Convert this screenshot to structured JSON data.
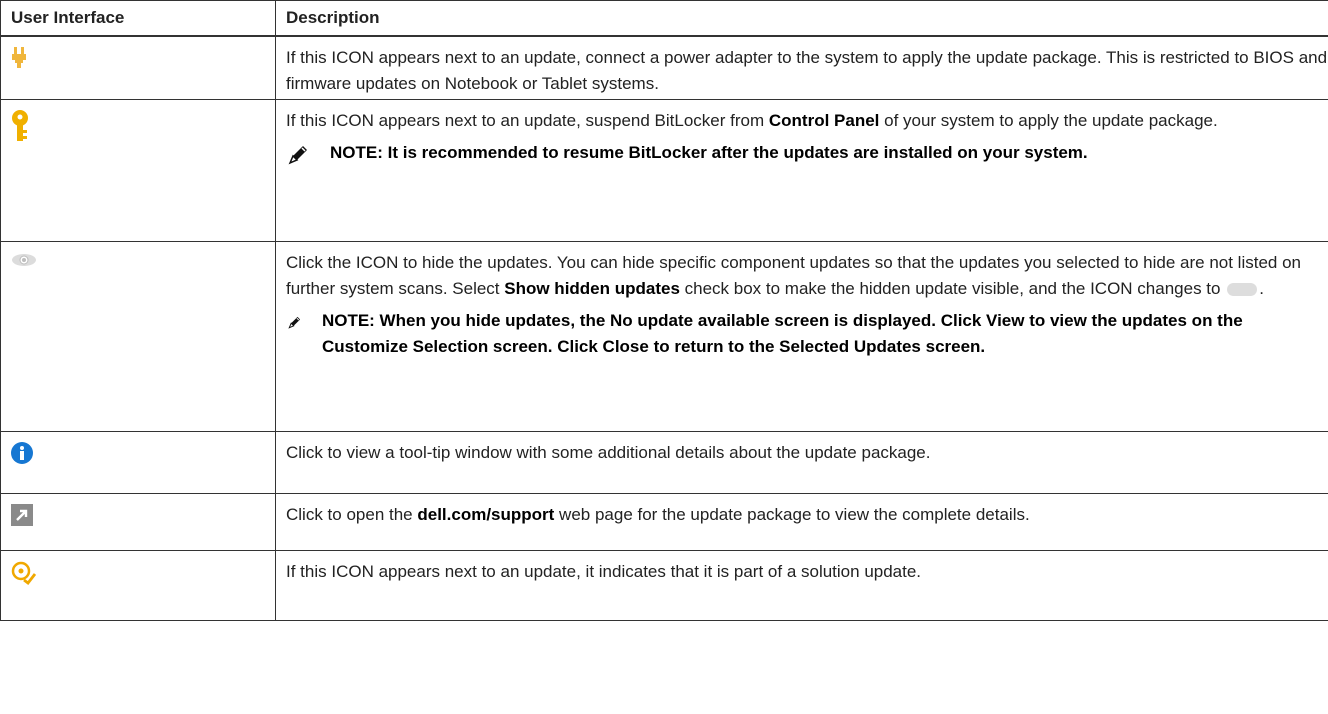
{
  "headers": {
    "ui": "User Interface",
    "desc": "Description"
  },
  "rows": [
    {
      "icon": "power-plug-icon",
      "text": "If this ICON appears next to an update, connect a power adapter to the system to apply the update package. This is restricted to BIOS and firmware updates on Notebook or Tablet systems."
    },
    {
      "icon": "key-icon",
      "text_a": "If this ICON appears next to an update, suspend BitLocker from ",
      "bold": "Control Panel",
      "text_b": " of your system to apply the update package.",
      "note": "NOTE: It is recommended to resume BitLocker after the updates are installed on your system."
    },
    {
      "icon": "eye-hide-icon",
      "text_a": "Click the ICON to hide the updates. You can hide specific component updates so that the updates you selected to hide are not listed on further system scans. Select ",
      "bold": "Show hidden updates",
      "text_b": " check box to make the hidden update visible, and the ICON changes to ",
      "text_c": ".",
      "note": "NOTE: When you hide updates, the No update available screen is displayed. Click View to view the updates on the Customize Selection screen. Click Close to return to the Selected Updates screen."
    },
    {
      "icon": "info-icon",
      "text": "Click to view a tool-tip window with some additional details about the update package."
    },
    {
      "icon": "external-link-icon",
      "text_a": "Click to open the ",
      "bold": "dell.com/support",
      "text_b": " web page for the update package to view the complete details."
    },
    {
      "icon": "solution-update-icon",
      "text": "If this ICON appears next to an update, it indicates that it is part of a solution update."
    }
  ]
}
